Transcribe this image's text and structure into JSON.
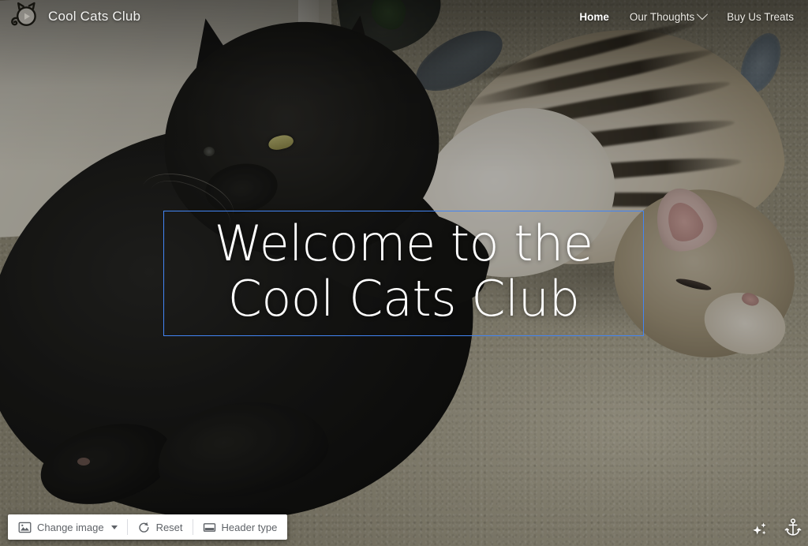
{
  "site": {
    "brand_title": "Cool Cats Club",
    "logo_icon": "cat-head-icon"
  },
  "nav": {
    "items": [
      {
        "label": "Home",
        "active": true,
        "has_dropdown": false
      },
      {
        "label": "Our Thoughts",
        "active": false,
        "has_dropdown": true,
        "dropdown_icon": "chevron-down-icon"
      },
      {
        "label": "Buy Us Treats",
        "active": false,
        "has_dropdown": false
      }
    ]
  },
  "hero": {
    "line1": "Welcome to the",
    "line2": "Cool Cats Club",
    "selection_border_color": "#4285f4",
    "text_color": "#ffffff",
    "background_description": "photo of a black cat and a tabby cat lying on light carpet"
  },
  "toolbar": {
    "change_image": {
      "label": "Change image",
      "icon": "image-icon",
      "caret_icon": "caret-down-icon"
    },
    "reset": {
      "label": "Reset",
      "icon": "reset-icon"
    },
    "header_type": {
      "label": "Header type",
      "icon": "header-layout-icon"
    }
  },
  "floating_icons": [
    {
      "name": "sparkles-icon",
      "color": "#ffffff"
    },
    {
      "name": "anchor-icon",
      "color": "#ffffff"
    }
  ]
}
